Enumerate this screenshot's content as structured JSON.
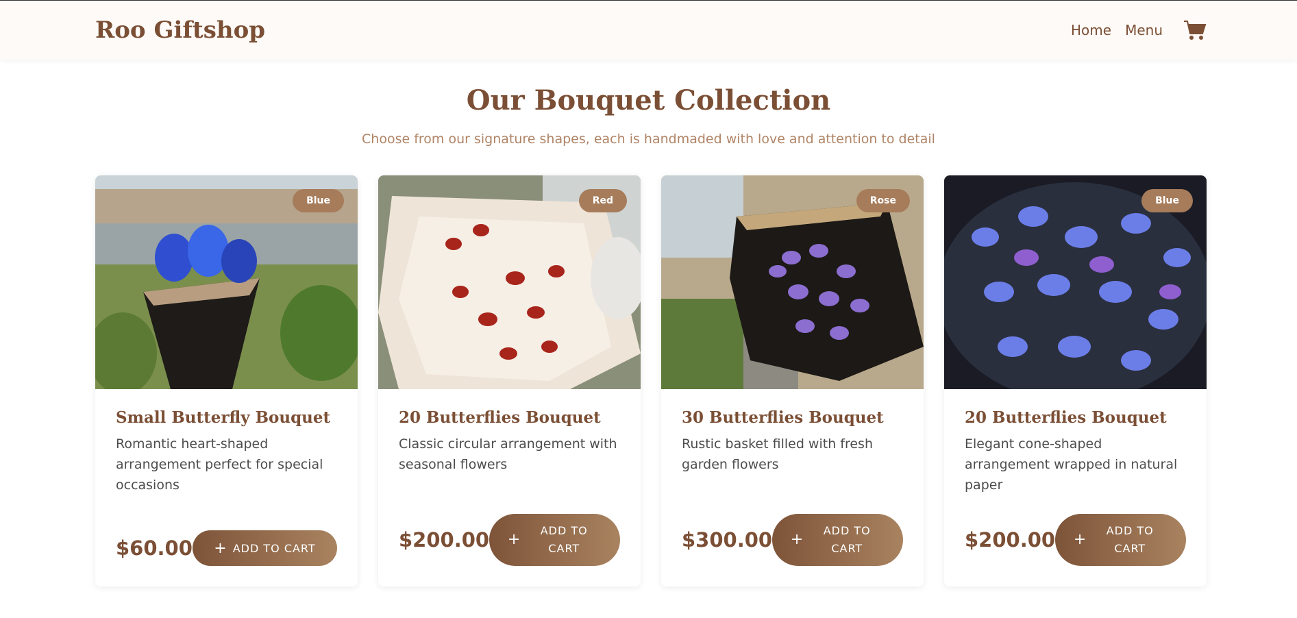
{
  "nav": {
    "brand": "Roo Giftshop",
    "links": [
      "Home",
      "Menu"
    ],
    "cart_icon": "shopping-cart-icon"
  },
  "section": {
    "title": "Our Bouquet Collection",
    "subtitle": "Choose from our signature shapes, each is handmaded with love and attention to detail"
  },
  "products": [
    {
      "badge": "Blue",
      "title": "Small Butterfly Bouquet",
      "description": "Romantic heart-shaped arrangement perfect for special occasions",
      "price": "$60.00",
      "button_label": "ADD TO CART"
    },
    {
      "badge": "Red",
      "title": "20 Butterflies Bouquet",
      "description": "Classic circular arrangement with seasonal flowers",
      "price": "$200.00",
      "button_label": "ADD TO CART"
    },
    {
      "badge": "Rose",
      "title": "30 Butterflies Bouquet",
      "description": "Rustic basket filled with fresh garden flowers",
      "price": "$300.00",
      "button_label": "ADD TO CART"
    },
    {
      "badge": "Blue",
      "title": "20 Butterflies Bouquet",
      "description": "Elegant cone-shaped arrangement wrapped in natural paper",
      "price": "$200.00",
      "button_label": "ADD TO CART"
    }
  ],
  "colors": {
    "brand": "#7b4f35",
    "accent": "#a67c5b",
    "subtitle": "#b08466"
  }
}
